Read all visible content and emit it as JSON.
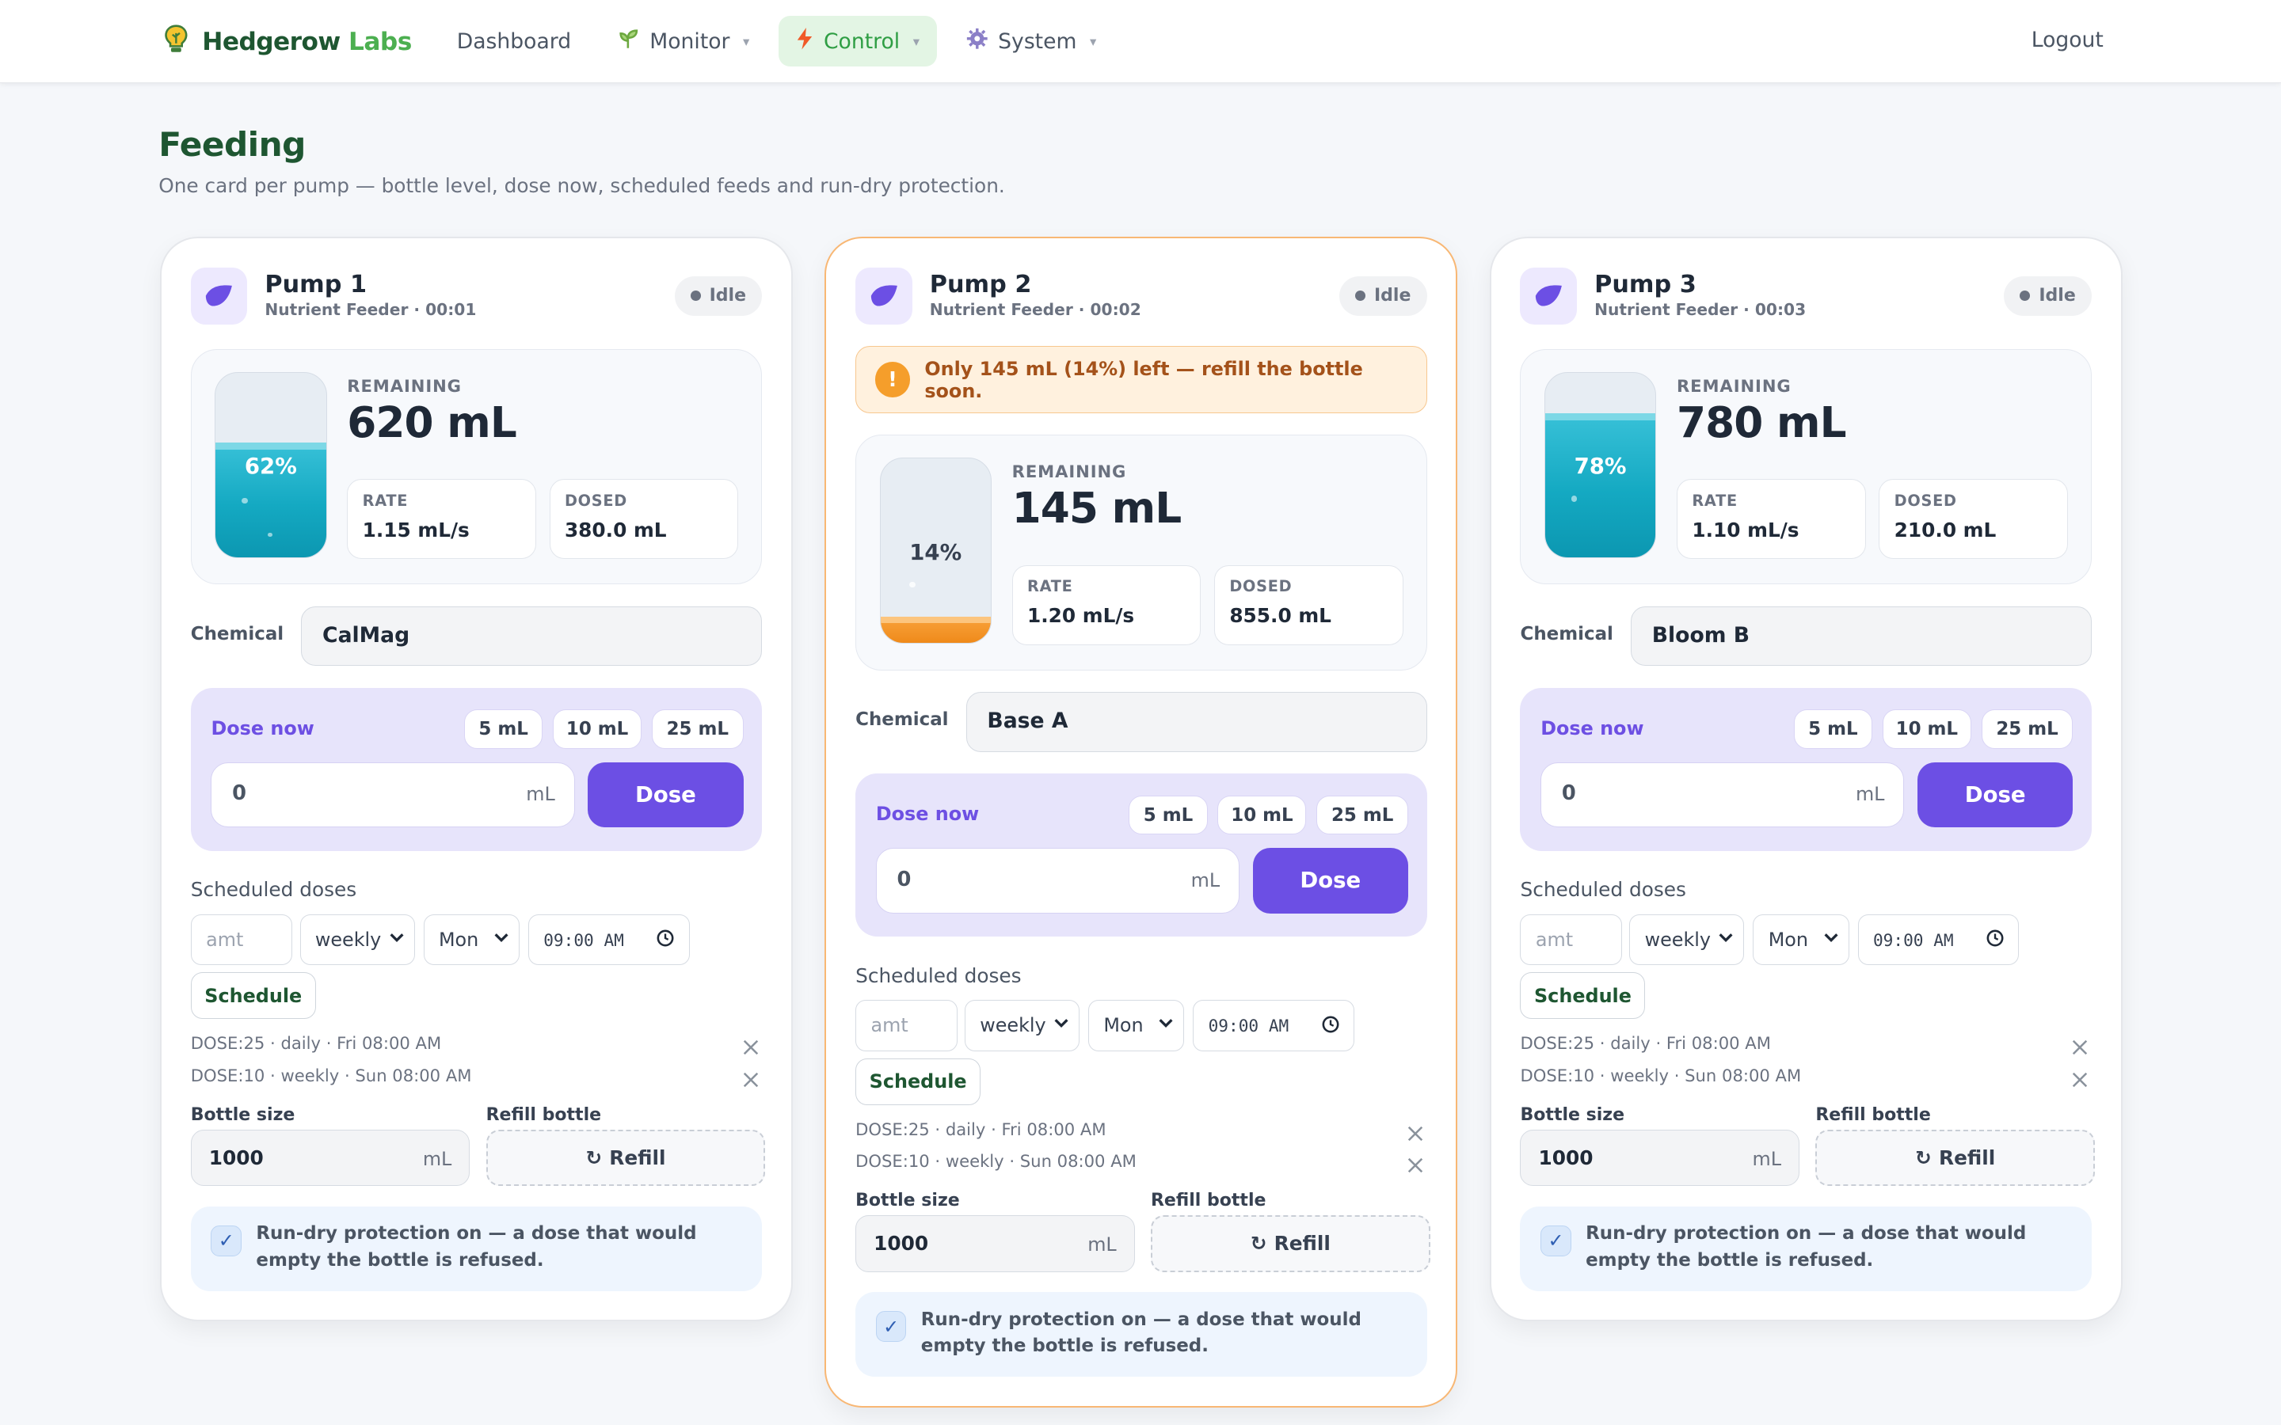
{
  "app": {
    "brand_part1": "Hedgerow",
    "brand_part2": "Labs"
  },
  "nav": {
    "dashboard": "Dashboard",
    "monitor": "Monitor",
    "control": "Control",
    "system": "System",
    "logout": "Logout"
  },
  "page": {
    "title": "Feeding",
    "subtitle": "One card per pump — bottle level, dose now, scheduled feeds and run-dry protection."
  },
  "labels": {
    "remaining": "REMAINING",
    "rate": "RATE",
    "dosed": "DOSED",
    "chemical": "Chemical",
    "dose_now": "Dose now",
    "preset_5": "5 mL",
    "preset_10": "10 mL",
    "preset_25": "25 mL",
    "unit_ml": "mL",
    "dose_button": "Dose",
    "scheduled_doses": "Scheduled doses",
    "amount_placeholder": "amt",
    "schedule_button": "Schedule",
    "bottle_size": "Bottle size",
    "refill_bottle": "Refill bottle",
    "refill_button": "Refill",
    "refill_glyph": "↻",
    "protection": "Run-dry protection on — a dose that would empty the bottle is refused."
  },
  "colors": {
    "accent_purple": "#6c4fe4",
    "brand_green": "#1e5631",
    "water": "#14a9c2",
    "warning": "#f59e2b"
  },
  "pumps": [
    {
      "name": "Pump 1",
      "subtitle": "Nutrient Feeder · 00:01",
      "status": "Idle",
      "level_fraction": 0.62,
      "level_percent": "62%",
      "remaining": "620 mL",
      "rate": "1.15 mL/s",
      "dosed": "380.0 mL",
      "chemical": "CalMag",
      "dose_amount": "0",
      "schedule_frequency": "weekly",
      "schedule_day": "Mon",
      "schedule_time": "09:00 AM",
      "scheduled": [
        "DOSE:25 · daily · Fri 08:00 AM",
        "DOSE:10 · weekly · Sun 08:00 AM"
      ],
      "bottle_size": "1000",
      "warning": ""
    },
    {
      "name": "Pump 2",
      "subtitle": "Nutrient Feeder · 00:02",
      "status": "Idle",
      "level_fraction": 0.14,
      "level_percent": "14%",
      "remaining": "145 mL",
      "rate": "1.20 mL/s",
      "dosed": "855.0 mL",
      "chemical": "Base A",
      "dose_amount": "0",
      "schedule_frequency": "weekly",
      "schedule_day": "Mon",
      "schedule_time": "09:00 AM",
      "scheduled": [
        "DOSE:25 · daily · Fri 08:00 AM",
        "DOSE:10 · weekly · Sun 08:00 AM"
      ],
      "bottle_size": "1000",
      "warning": "Only 145 mL (14%) left — refill the bottle soon."
    },
    {
      "name": "Pump 3",
      "subtitle": "Nutrient Feeder · 00:03",
      "status": "Idle",
      "level_fraction": 0.78,
      "level_percent": "78%",
      "remaining": "780 mL",
      "rate": "1.10 mL/s",
      "dosed": "210.0 mL",
      "chemical": "Bloom B",
      "dose_amount": "0",
      "schedule_frequency": "weekly",
      "schedule_day": "Mon",
      "schedule_time": "09:00 AM",
      "scheduled": [
        "DOSE:25 · daily · Fri 08:00 AM",
        "DOSE:10 · weekly · Sun 08:00 AM"
      ],
      "bottle_size": "1000",
      "warning": ""
    }
  ]
}
